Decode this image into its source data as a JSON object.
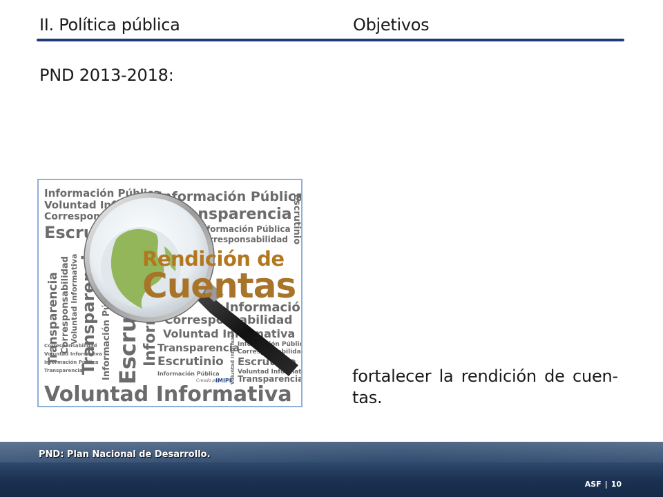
{
  "header": {
    "section": "II. Política pública",
    "topic": "Objetivos"
  },
  "subtitle": "PND 2013-2018:",
  "image": {
    "words": {
      "info_publica": "Información Pública",
      "voluntad": "Voluntad Informativa",
      "corresp": "Corresponsabilidad",
      "escrutinio": "Escrutinio",
      "transparencia": "Transparencia",
      "rendicion": "Rendición de",
      "cuentas": "Cuentas",
      "creado": "Creado por:",
      "imipe": "IMIPE"
    },
    "colors": {
      "word_gray": "#6b6b6b",
      "title_orange": "#b3781f",
      "globe_green": "#8bb04a"
    },
    "icons": [
      "magnifying-glass-icon",
      "globe-icon"
    ]
  },
  "body": {
    "text": "fortalecer la rendición de cuen-tas."
  },
  "footer": {
    "note": "PND: Plan Nacional de Desarrollo.",
    "org": "ASF",
    "separator": "|",
    "page": "10"
  }
}
